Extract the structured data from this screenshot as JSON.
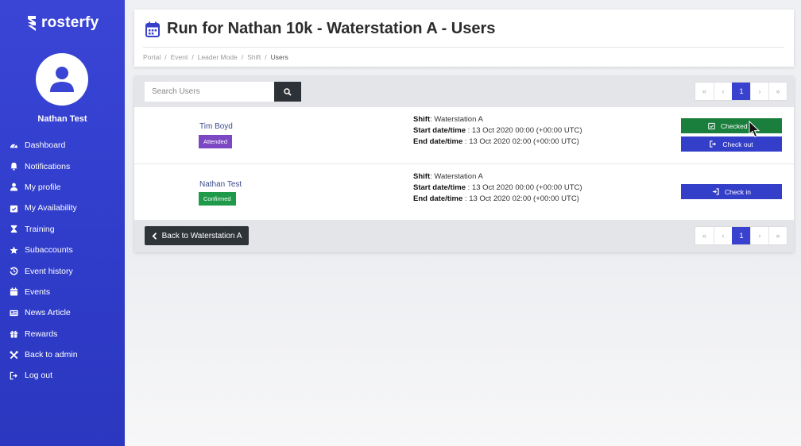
{
  "brand": {
    "name": "rosterfy"
  },
  "user": {
    "name": "Nathan Test"
  },
  "nav": [
    {
      "label": "Dashboard",
      "icon": "dashboard-icon"
    },
    {
      "label": "Notifications",
      "icon": "bell-icon"
    },
    {
      "label": "My profile",
      "icon": "user-icon"
    },
    {
      "label": "My Availability",
      "icon": "calendar-check-icon"
    },
    {
      "label": "Training",
      "icon": "hourglass-icon"
    },
    {
      "label": "Subaccounts",
      "icon": "star-icon"
    },
    {
      "label": "Event history",
      "icon": "history-icon"
    },
    {
      "label": "Events",
      "icon": "calendar-icon"
    },
    {
      "label": "News Article",
      "icon": "newspaper-icon"
    },
    {
      "label": "Rewards",
      "icon": "gift-icon"
    },
    {
      "label": "Back to admin",
      "icon": "tools-icon"
    },
    {
      "label": "Log out",
      "icon": "logout-icon"
    }
  ],
  "header": {
    "title": "Run for Nathan 10k - Waterstation A - Users",
    "breadcrumb": [
      "Portal",
      "Event",
      "Leader Mode",
      "Shift",
      "Users"
    ],
    "separator": "/"
  },
  "search": {
    "placeholder": "Search Users"
  },
  "pagination": {
    "first": "«",
    "prev": "‹",
    "current": "1",
    "next": "›",
    "last": "»"
  },
  "labels": {
    "shift": "Shift",
    "start": "Start date/time",
    "end": "End date/time"
  },
  "rows": [
    {
      "name": "Tim Boyd",
      "status": "Attended",
      "shift": ": Waterstation A",
      "start": " : 13 Oct 2020 00:00 (+00:00 UTC)",
      "end": " : 13 Oct 2020 02:00 (+00:00 UTC)",
      "actions": [
        "Checked In",
        "Check out"
      ]
    },
    {
      "name": "Nathan Test",
      "status": "Confirmed",
      "shift": ": Waterstation A",
      "start": " : 13 Oct 2020 00:00 (+00:00 UTC)",
      "end": " : 13 Oct 2020 02:00 (+00:00 UTC)",
      "actions": [
        "Check in"
      ]
    }
  ],
  "back_button": {
    "label": "Back to Waterstation A"
  },
  "colors": {
    "sidebar": "#3a45d6",
    "primary": "#333ec9",
    "success": "#1a7f3c",
    "attended": "#7b47c2",
    "confirmed": "#1f9a4a",
    "dark": "#2f3438"
  }
}
